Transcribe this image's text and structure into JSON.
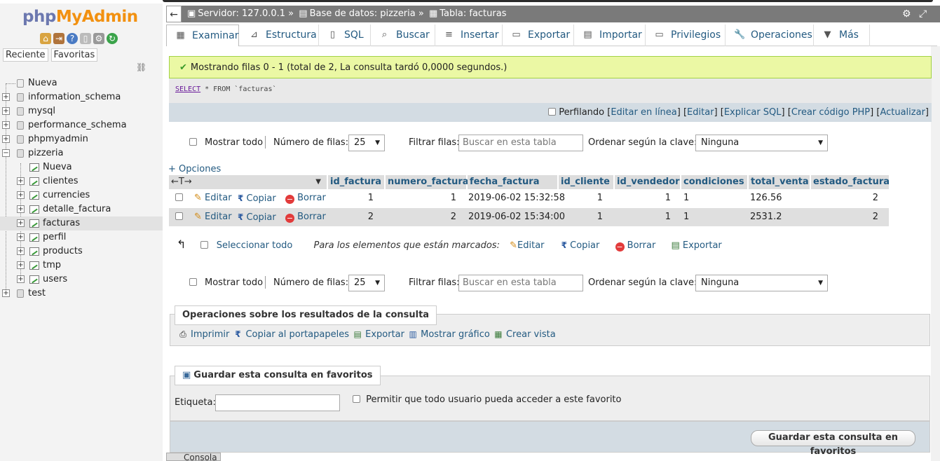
{
  "nav": {
    "logo_php": "php",
    "logo_myadmin": "MyAdmin",
    "icons": [
      "home-icon",
      "exit-icon",
      "help-icon",
      "docs-icon",
      "settings-icon",
      "reload-icon"
    ],
    "tabs": [
      "Reciente",
      "Favoritas"
    ],
    "tree": [
      {
        "label": "Nueva",
        "kind": "new",
        "level": 0
      },
      {
        "label": "information_schema",
        "kind": "db",
        "level": 0
      },
      {
        "label": "mysql",
        "kind": "db",
        "level": 0
      },
      {
        "label": "performance_schema",
        "kind": "db",
        "level": 0
      },
      {
        "label": "phpmyadmin",
        "kind": "db",
        "level": 0
      },
      {
        "label": "pizzeria",
        "kind": "db-open",
        "level": 0
      },
      {
        "label": "Nueva",
        "kind": "new-table",
        "level": 1
      },
      {
        "label": "clientes",
        "kind": "table",
        "level": 1
      },
      {
        "label": "currencies",
        "kind": "table",
        "level": 1
      },
      {
        "label": "detalle_factura",
        "kind": "table",
        "level": 1
      },
      {
        "label": "facturas",
        "kind": "table",
        "level": 1,
        "selected": true
      },
      {
        "label": "perfil",
        "kind": "table",
        "level": 1
      },
      {
        "label": "products",
        "kind": "table",
        "level": 1
      },
      {
        "label": "tmp",
        "kind": "table",
        "level": 1
      },
      {
        "label": "users",
        "kind": "table",
        "level": 1
      },
      {
        "label": "test",
        "kind": "db",
        "level": 0
      }
    ]
  },
  "breadcrumb": {
    "back": "←",
    "server": "Servidor: 127.0.0.1 »",
    "database": "Base de datos: pizzeria »",
    "table": "Tabla: facturas"
  },
  "tabs": [
    {
      "label": "Examinar",
      "icon": "browse-icon",
      "active": true
    },
    {
      "label": "Estructura",
      "icon": "structure-icon"
    },
    {
      "label": "SQL",
      "icon": "sql-icon"
    },
    {
      "label": "Buscar",
      "icon": "search-icon"
    },
    {
      "label": "Insertar",
      "icon": "insert-icon"
    },
    {
      "label": "Exportar",
      "icon": "export-icon"
    },
    {
      "label": "Importar",
      "icon": "import-icon"
    },
    {
      "label": "Privilegios",
      "icon": "privileges-icon"
    },
    {
      "label": "Operaciones",
      "icon": "wrench-icon"
    },
    {
      "label": "Más",
      "icon": "chevron-down-icon"
    }
  ],
  "result": {
    "success_message": "Mostrando filas 0 - 1 (total de 2, La consulta tardó 0,0000 segundos.)",
    "sql_keyword": "SELECT",
    "sql_rest": " * FROM `facturas`",
    "profiling_label": "Perfilando",
    "profiling_links": [
      "Editar en línea",
      "Editar",
      "Explicar SQL",
      "Crear código PHP",
      "Actualizar"
    ]
  },
  "controls": {
    "show_all": "Mostrar todo",
    "rows_label": "Número de filas:",
    "rows_value": "25",
    "filter_label": "Filtrar filas:",
    "filter_placeholder": "Buscar en esta tabla",
    "sort_label": "Ordenar según la clave:",
    "sort_value": "Ninguna"
  },
  "options_link": "+ Opciones",
  "table": {
    "arrows": "←T→",
    "columns": [
      "id_factura",
      "numero_factura",
      "fecha_factura",
      "id_cliente",
      "id_vendedor",
      "condiciones",
      "total_venta",
      "estado_factura"
    ],
    "actions": {
      "edit": "Editar",
      "copy": "Copiar",
      "delete": "Borrar"
    },
    "rows": [
      [
        "1",
        "1",
        "2019-06-02 15:32:58",
        "1",
        "1",
        "1",
        "126.56",
        "2"
      ],
      [
        "2",
        "2",
        "2019-06-02 15:34:00",
        "1",
        "1",
        "1",
        "2531.2",
        "2"
      ]
    ]
  },
  "bulk": {
    "select_all": "Seleccionar todo",
    "marked_label": "Para los elementos que están marcados:",
    "edit": "Editar",
    "copy": "Copiar",
    "delete": "Borrar",
    "export": "Exportar"
  },
  "query_ops": {
    "legend": "Operaciones sobre los resultados de la consulta",
    "print": "Imprimir",
    "copy_clipboard": "Copiar al portapapeles",
    "export": "Exportar",
    "chart": "Mostrar gráfico",
    "view": "Crear vista"
  },
  "bookmark": {
    "legend": "Guardar esta consulta en favoritos",
    "label": "Etiqueta:",
    "shared": "Permitir que todo usuario pueda acceder a este favorito",
    "button": "Guardar esta consulta en favoritos"
  },
  "console": "Consola"
}
